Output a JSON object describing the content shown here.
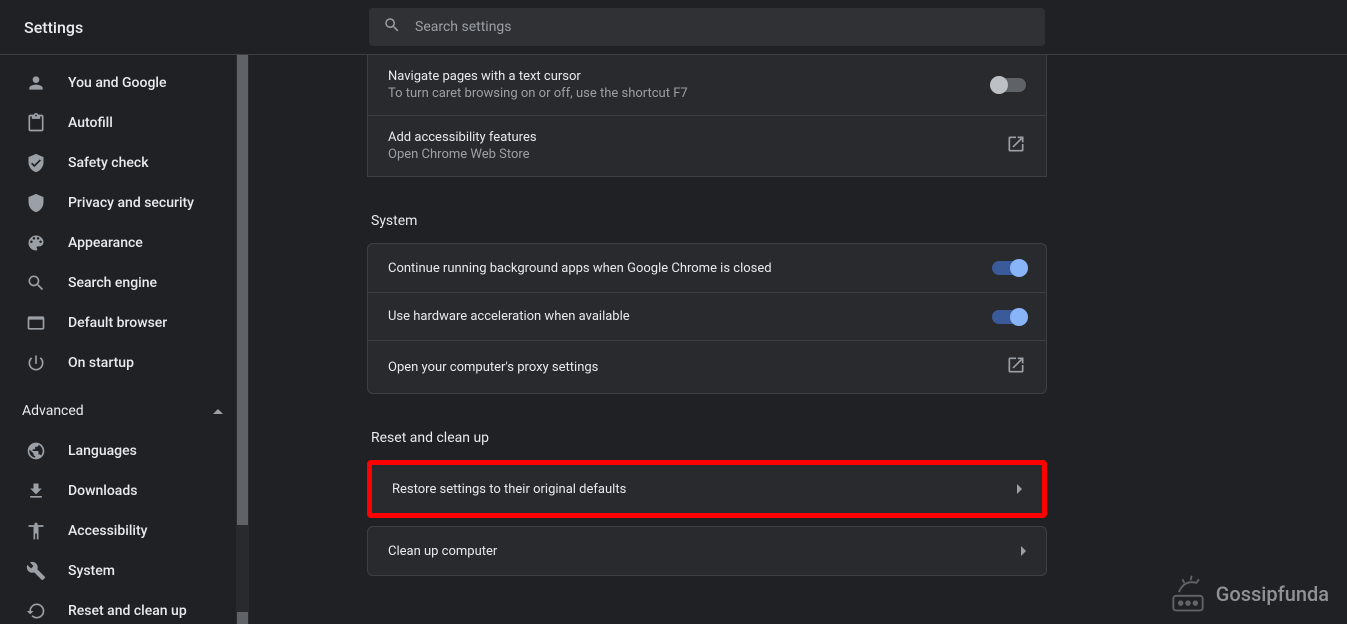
{
  "header": {
    "title": "Settings",
    "search_placeholder": "Search settings"
  },
  "sidebar": {
    "items": [
      {
        "label": "You and Google"
      },
      {
        "label": "Autofill"
      },
      {
        "label": "Safety check"
      },
      {
        "label": "Privacy and security"
      },
      {
        "label": "Appearance"
      },
      {
        "label": "Search engine"
      },
      {
        "label": "Default browser"
      },
      {
        "label": "On startup"
      }
    ],
    "advanced_label": "Advanced",
    "advanced_items": [
      {
        "label": "Languages"
      },
      {
        "label": "Downloads"
      },
      {
        "label": "Accessibility"
      },
      {
        "label": "System"
      },
      {
        "label": "Reset and clean up"
      }
    ]
  },
  "main": {
    "accessibility_rows": [
      {
        "title": "Navigate pages with a text cursor",
        "sub": "To turn caret browsing on or off, use the shortcut F7",
        "toggle": "off"
      },
      {
        "title": "Add accessibility features",
        "sub": "Open Chrome Web Store",
        "action": "external"
      }
    ],
    "system_title": "System",
    "system_rows": [
      {
        "title": "Continue running background apps when Google Chrome is closed",
        "toggle": "on"
      },
      {
        "title": "Use hardware acceleration when available",
        "toggle": "on"
      },
      {
        "title": "Open your computer's proxy settings",
        "action": "external"
      }
    ],
    "reset_title": "Reset and clean up",
    "reset_rows": [
      {
        "title": "Restore settings to their original defaults",
        "action": "arrow",
        "highlight": true
      },
      {
        "title": "Clean up computer",
        "action": "arrow"
      }
    ]
  },
  "watermark": "Gossipfunda"
}
